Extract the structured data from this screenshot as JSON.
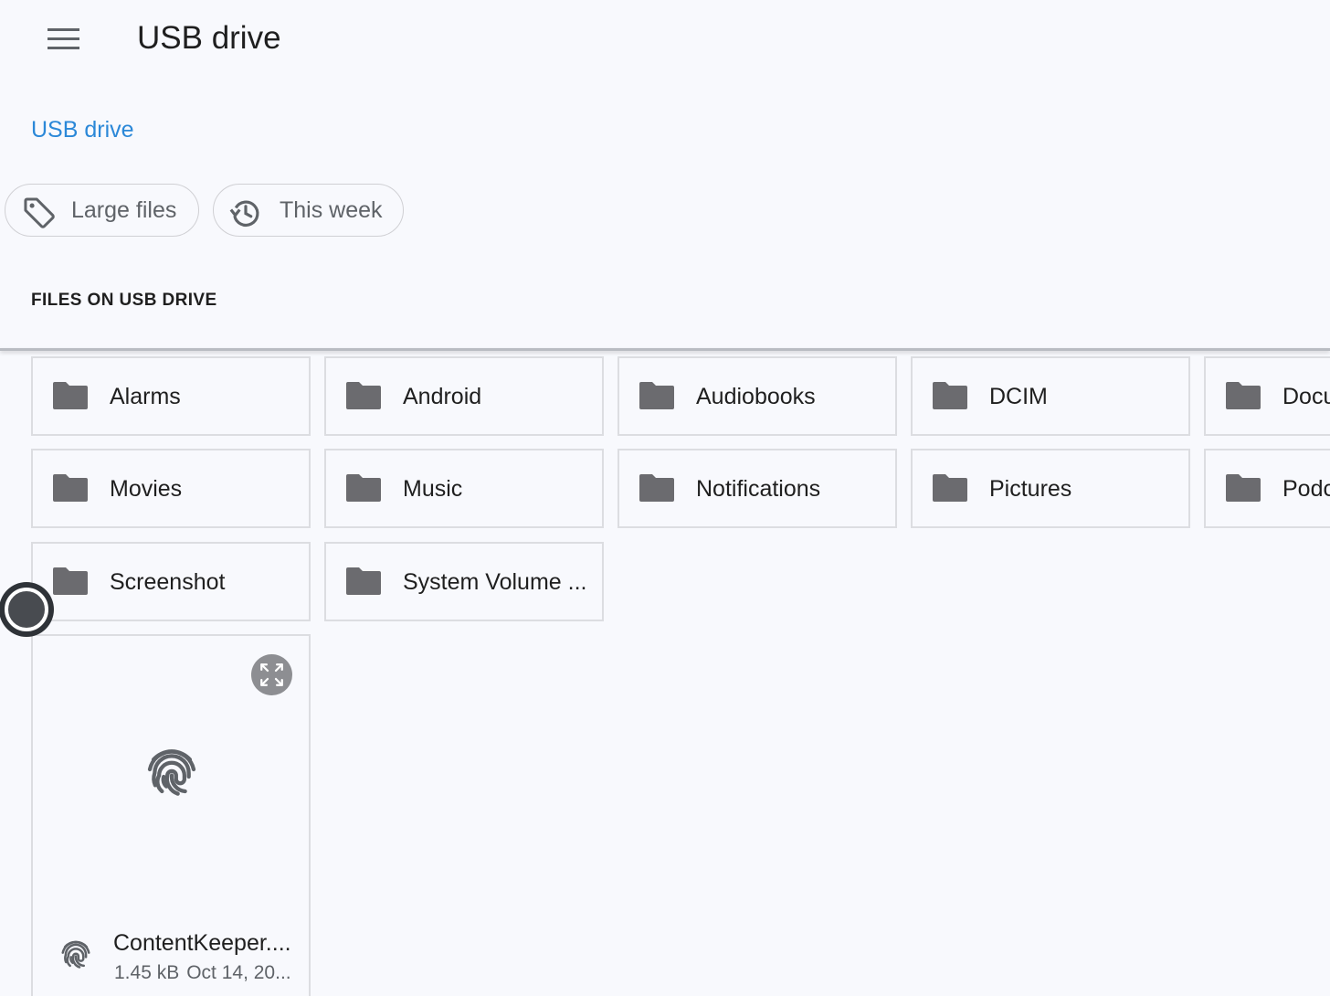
{
  "header": {
    "title": "USB drive",
    "menu_icon": "hamburger-menu-icon"
  },
  "breadcrumb": {
    "label": "USB drive"
  },
  "filters": [
    {
      "label": "Large files",
      "icon": "tag-icon"
    },
    {
      "label": "This week",
      "icon": "history-icon"
    }
  ],
  "section": {
    "title": "FILES ON USB DRIVE"
  },
  "folders": [
    {
      "name": "Alarms"
    },
    {
      "name": "Android"
    },
    {
      "name": "Audiobooks"
    },
    {
      "name": "DCIM"
    },
    {
      "name": "Docu"
    },
    {
      "name": "Movies"
    },
    {
      "name": "Music"
    },
    {
      "name": "Notifications"
    },
    {
      "name": "Pictures"
    },
    {
      "name": "Podc"
    },
    {
      "name": "Screenshot"
    },
    {
      "name": "System Volume ..."
    }
  ],
  "file": {
    "name": "ContentKeeper....",
    "size": "1.45 kB",
    "date": "Oct 14, 20...",
    "icon": "fingerprint-icon",
    "expand_icon": "expand-icon"
  },
  "colors": {
    "background": "#f8f9fd",
    "accent": "#2b88d8",
    "folder_icon": "#6b6b6f",
    "border": "#dcdde1"
  }
}
